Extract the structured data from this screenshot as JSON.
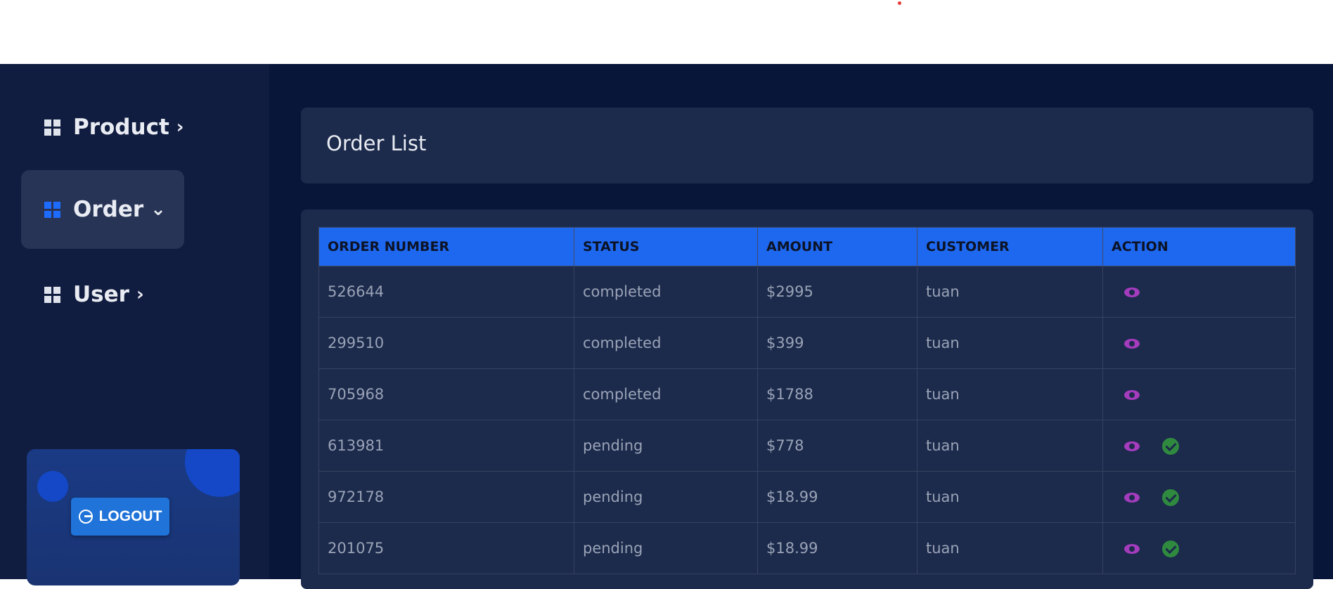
{
  "sidebar": {
    "items": [
      {
        "label": "Product",
        "chevron": "›",
        "icon": "dashboard-icon"
      },
      {
        "label": "Order",
        "chevron": "⌄",
        "icon": "dashboard-icon",
        "active": true
      },
      {
        "label": "User",
        "chevron": "›",
        "icon": "dashboard-icon"
      }
    ],
    "logout_label": "LOGOUT"
  },
  "page": {
    "title": "Order List"
  },
  "table": {
    "headers": [
      "ORDER NUMBER",
      "STATUS",
      "AMOUNT",
      "CUSTOMER",
      "ACTION"
    ],
    "rows": [
      {
        "order": "526644",
        "status": "completed",
        "amount": "$2995",
        "customer": "tuan",
        "actions": [
          "view"
        ]
      },
      {
        "order": "299510",
        "status": "completed",
        "amount": "$399",
        "customer": "tuan",
        "actions": [
          "view"
        ]
      },
      {
        "order": "705968",
        "status": "completed",
        "amount": "$1788",
        "customer": "tuan",
        "actions": [
          "view"
        ]
      },
      {
        "order": "613981",
        "status": "pending",
        "amount": "$778",
        "customer": "tuan",
        "actions": [
          "view",
          "approve"
        ]
      },
      {
        "order": "972178",
        "status": "pending",
        "amount": "$18.99",
        "customer": "tuan",
        "actions": [
          "view",
          "approve"
        ]
      },
      {
        "order": "201075",
        "status": "pending",
        "amount": "$18.99",
        "customer": "tuan",
        "actions": [
          "view",
          "approve"
        ]
      }
    ]
  },
  "colors": {
    "accent": "#1e68f0",
    "view_icon": "#a43cbd",
    "approve_icon": "#2f8a3f"
  }
}
